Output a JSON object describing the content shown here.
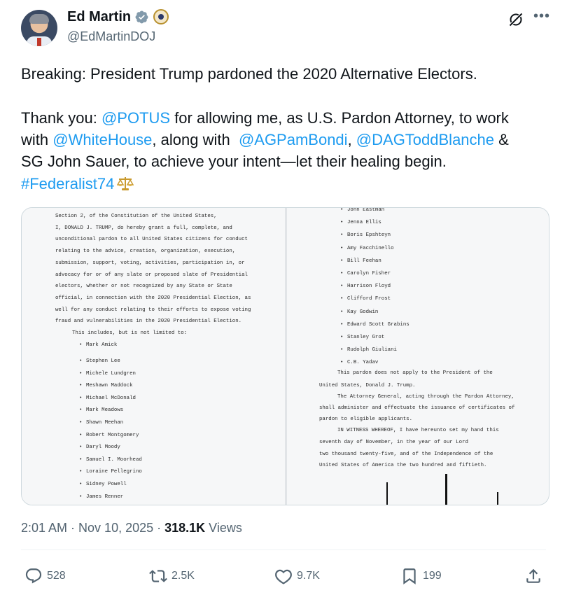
{
  "author": {
    "name": "Ed Martin",
    "handle": "@EdMartinDOJ"
  },
  "post": {
    "line1": "Breaking: President Trump pardoned the 2020 Alternative Electors.",
    "thanks_prefix": "Thank you: ",
    "mention_potus": "@POTUS",
    "thanks_rest1": " for allowing me, as U.S. Pardon Attorney, to work",
    "with_prefix": "with ",
    "mention_whitehouse": "@WhiteHouse",
    "with_mid": ", along with  ",
    "mention_agpambondi": "@AGPamBondi",
    "comma": ", ",
    "mention_dagtoddblanche": "@DAGToddBlanche",
    "ampersand": " &",
    "line4": "SG John Sauer, to achieve your intent—let their healing begin.",
    "hashtag": "#Federalist74"
  },
  "document": {
    "left_paragraph": [
      "Section 2, of the Constitution of the United States,",
      "I, DONALD J. TRUMP, do hereby grant a full, complete, and",
      "unconditional pardon to all United States citizens for conduct",
      "relating to the advice, creation, organization, execution,",
      "submission, support, voting, activities, participation in, or",
      "advocacy for or of any slate or proposed slate of Presidential",
      "electors, whether or not recognized by any State or State",
      "official, in connection with the 2020 Presidential Election, as",
      "well for any conduct relating to their efforts to expose voting",
      "fraud and vulnerabilities in the 2020 Presidential Election.",
      "This includes, but is not limited to:"
    ],
    "left_names": [
      "Mark Amick",
      "Stephen Lee",
      "Michele Lundgren",
      "Meshawn Maddock",
      "Michael McDonald",
      "Mark Meadows",
      "Shawn Meehan",
      "Robert Montgomery",
      "Daryl Moody",
      "Samuel I. Moorhead",
      "Loraine Pellegrino",
      "Sidney Powell",
      "James Renner"
    ],
    "right_names": [
      "John Eastman",
      "Jenna Ellis",
      "Boris Epshteyn",
      "Amy Facchinello",
      "Bill Feehan",
      "Carolyn Fisher",
      "Harrison Floyd",
      "Clifford Frost",
      "Kay Godwin",
      "Edward Scott Grabins",
      "Stanley Grot",
      "Rudolph Giuliani",
      "C.B. Yadav"
    ],
    "right_paragraph": [
      "This pardon does not apply to the President of the",
      "United States, Donald J. Trump.",
      "The Attorney General, acting through the Pardon Attorney,",
      "shall administer and effectuate the issuance of certificates of",
      "pardon to eligible applicants.",
      "IN WITNESS WHEREOF, I have hereunto set my hand this",
      "seventh day of November, in the year of our Lord",
      "two thousand twenty-five, and of the Independence of the",
      "United States of America the two hundred and fiftieth."
    ]
  },
  "meta": {
    "time": "2:01 AM",
    "dot1": " · ",
    "date": "Nov 10, 2025",
    "dot2": " · ",
    "views_count": "318.1K",
    "views_label": " Views"
  },
  "actions": {
    "replies": "528",
    "reposts": "2.5K",
    "likes": "9.7K",
    "bookmarks": "199"
  },
  "icons": {
    "verified": "verified-badge-icon",
    "affiliation": "doj-seal-icon",
    "grok": "grok-icon",
    "more": "more-icon",
    "reply": "reply-icon",
    "repost": "repost-icon",
    "like": "heart-icon",
    "bookmark": "bookmark-icon",
    "share": "share-icon",
    "hashtag_emoji": "balance-scale-icon"
  },
  "colors": {
    "link": "#1d9bf0",
    "text": "#0f1419",
    "secondary": "#536471",
    "verified": "#829aab"
  }
}
